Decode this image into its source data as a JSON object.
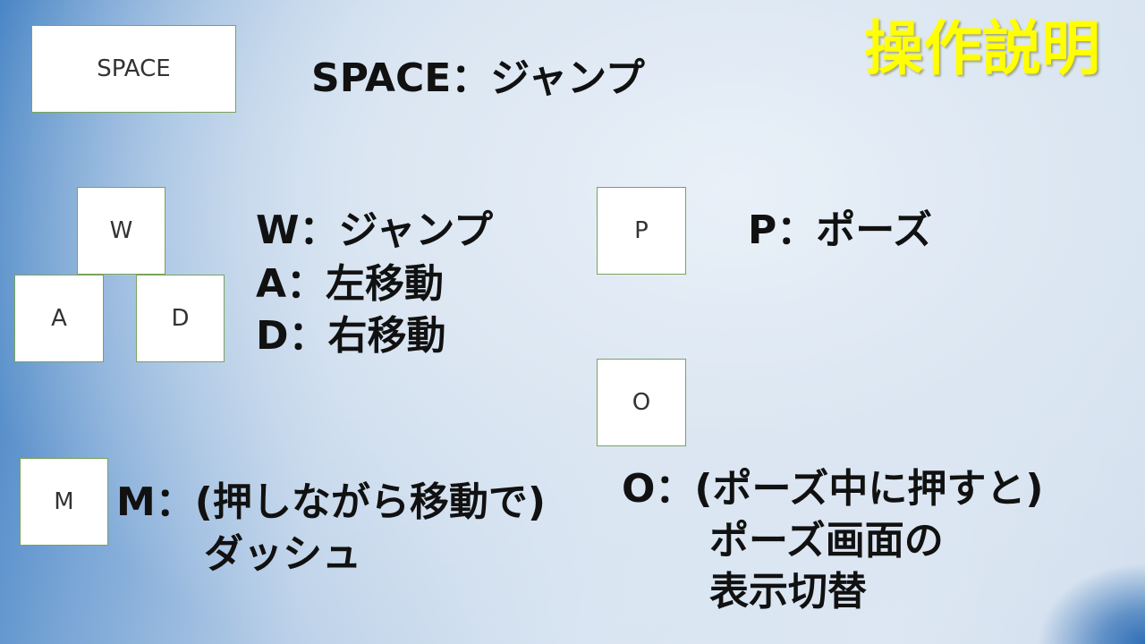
{
  "title": "操作説明",
  "keys": {
    "space": "SPACE",
    "w": "W",
    "a": "A",
    "d": "D",
    "p": "P",
    "o": "O",
    "m": "M"
  },
  "descriptions": {
    "space": "SPACE：ジャンプ",
    "w": "W：ジャンプ",
    "a": "A：左移動",
    "d": "D：右移動",
    "p": "P：ポーズ",
    "m_line1": "M：(押しながら移動で)",
    "m_line2": "ダッシュ",
    "o_line1": "O：(ポーズ中に押すと)",
    "o_line2": "ポーズ画面の",
    "o_line3": "表示切替"
  },
  "colors": {
    "title": "#ffff00",
    "key_border": "#7aa35b",
    "text": "#111111"
  }
}
